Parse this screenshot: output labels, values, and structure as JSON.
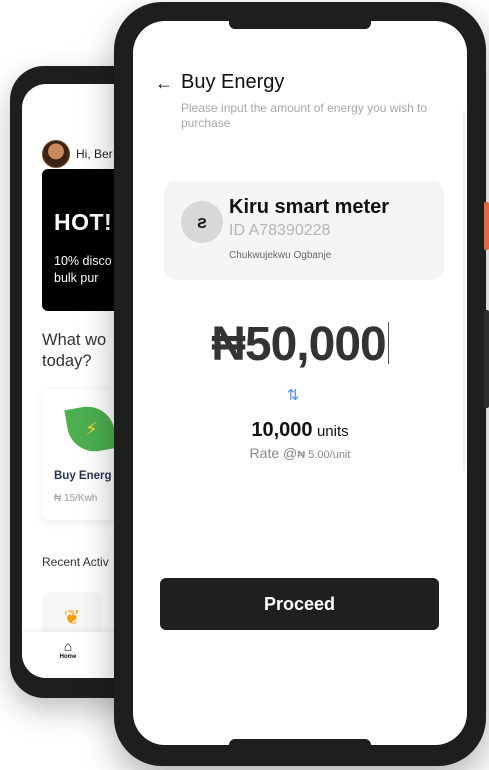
{
  "back_screen": {
    "greeting": "Hi, Ber",
    "banner_title": "HOT!",
    "banner_text": "10% disco bulk pur",
    "question": "What wo today?",
    "card_title": "Buy Energ",
    "card_price": "₦ 15/Kwh",
    "recent_label": "Recent Activ",
    "nav_home": "Home"
  },
  "header": {
    "title": "Buy Energy",
    "subtitle": "Please input the amount of energy you wish to purchase"
  },
  "meter": {
    "logo_letter": "ƨ",
    "name": "Kiru smart meter",
    "id": "ID A78390228",
    "owner": "Chukwujekwu Ogbanje"
  },
  "amount": {
    "value": "₦50,000",
    "swap_symbol": "⇅"
  },
  "conversion": {
    "units_value": "10,000",
    "units_label": "units",
    "rate_prefix": "Rate @",
    "rate_value": "₦ 5.00/unit"
  },
  "actions": {
    "proceed_label": "Proceed"
  },
  "colors": {
    "accent_dark": "#1f1f1f",
    "swap_blue": "#4a8fe7",
    "leaf_green": "#4caf50",
    "orange_button": "#e06a3b"
  }
}
